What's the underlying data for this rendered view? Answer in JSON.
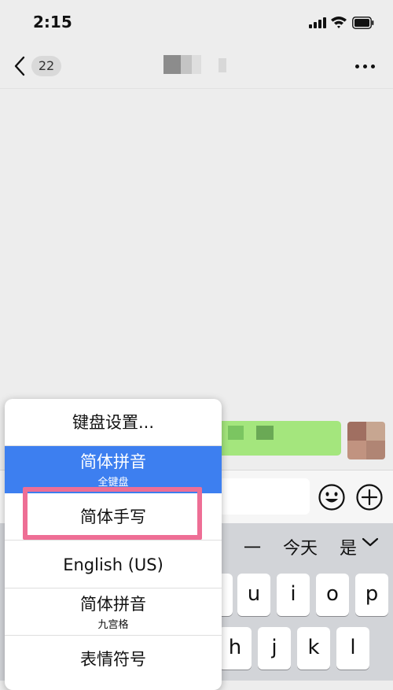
{
  "status_bar": {
    "time": "2:15",
    "icons": [
      "cellular-signal-icon",
      "wifi-icon",
      "battery-icon"
    ]
  },
  "nav_bar": {
    "back_icon": "chevron-left-icon",
    "unread_count": "22",
    "more_icon": "ellipsis-icon"
  },
  "input_bar": {
    "emoji_icon": "smiley-face-icon",
    "add_icon": "plus-circle-icon"
  },
  "keyboard": {
    "candidates": [
      "一",
      "今天",
      "是"
    ],
    "collapse_icon": "chevron-down-icon",
    "row1": [
      "u",
      "i",
      "o",
      "p"
    ],
    "row2": [
      "h",
      "j",
      "k",
      "l"
    ]
  },
  "ime_menu": {
    "items": [
      {
        "label": "键盘设置...",
        "sublabel": ""
      },
      {
        "label": "简体拼音",
        "sublabel": "全键盘",
        "selected": true
      },
      {
        "label": "简体手写",
        "sublabel": ""
      },
      {
        "label": "English (US)",
        "sublabel": ""
      },
      {
        "label": "简体拼音",
        "sublabel": "九宫格"
      },
      {
        "label": "表情符号",
        "sublabel": ""
      }
    ],
    "highlight_color": "#ee6e95",
    "selected_color": "#3d7ff0"
  },
  "colors": {
    "chat_background": "#ededed",
    "bubble_green": "#a4e67d",
    "keyboard_background": "#d2d4d8"
  }
}
